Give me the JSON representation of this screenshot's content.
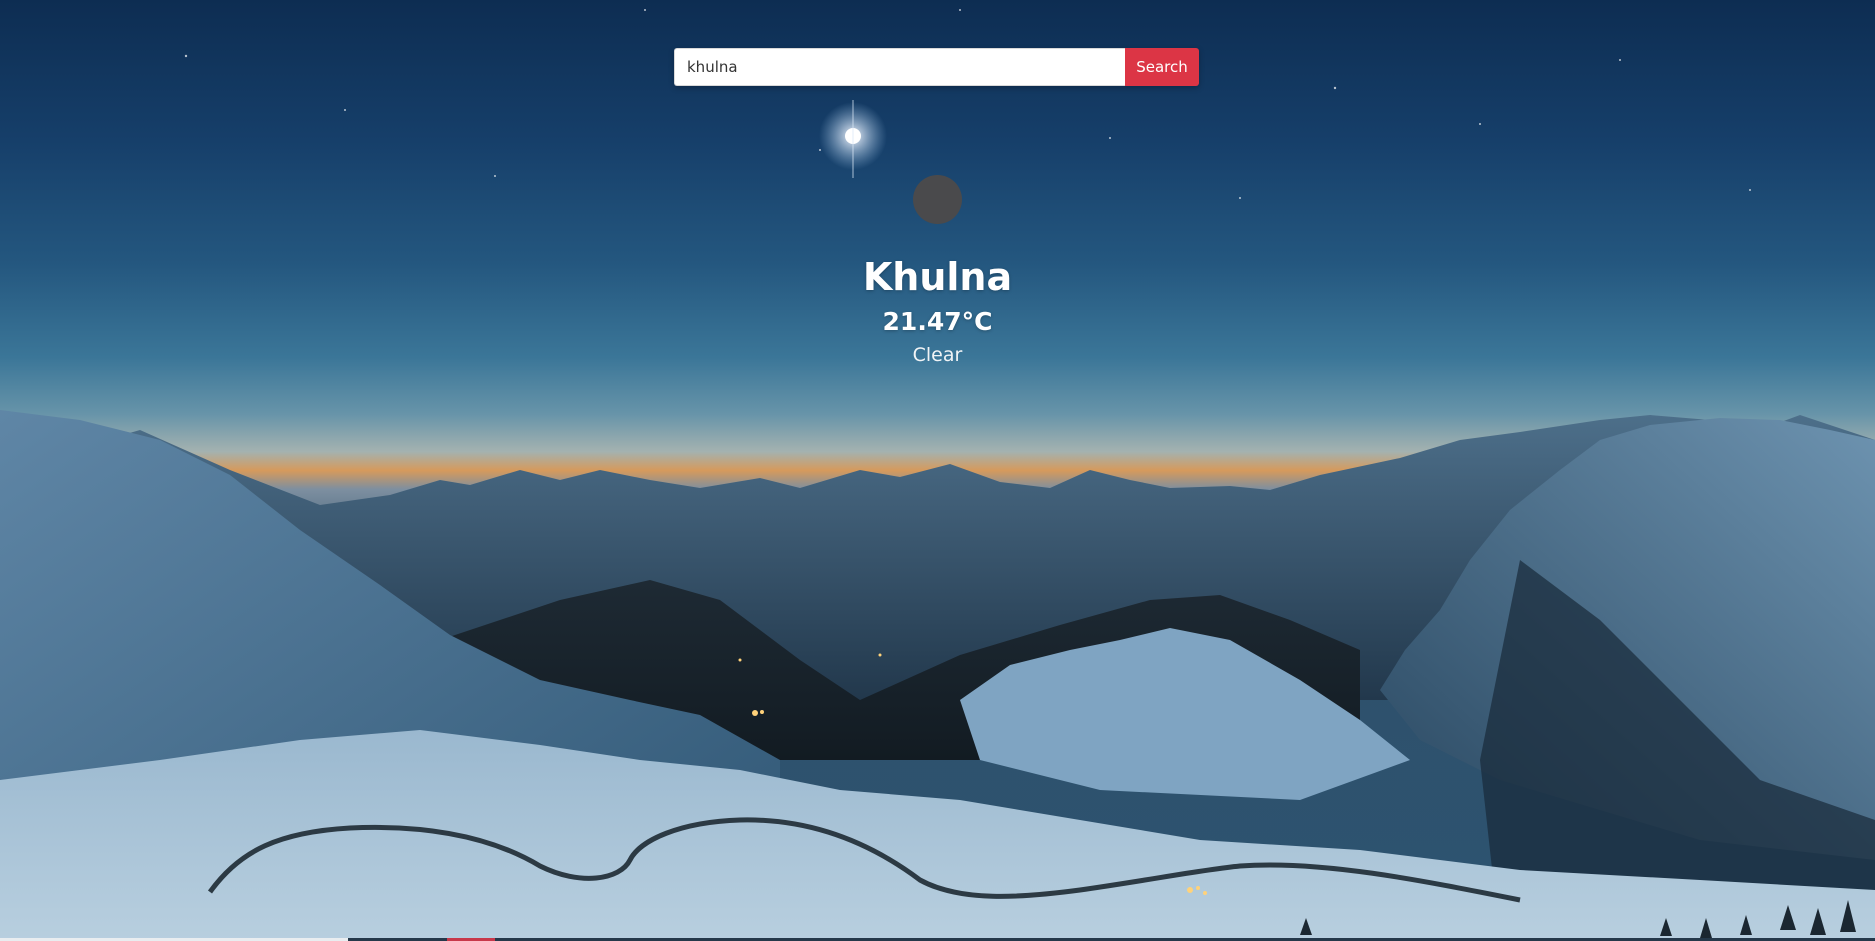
{
  "search": {
    "value": "khulna",
    "button_label": "Search"
  },
  "weather": {
    "icon": "weather-icon",
    "city": "Khulna",
    "temperature": "21.47°C",
    "condition": "Clear"
  },
  "colors": {
    "search_button": "#dc3545",
    "text": "#ffffff",
    "icon_placeholder": "#4a4a4c"
  }
}
